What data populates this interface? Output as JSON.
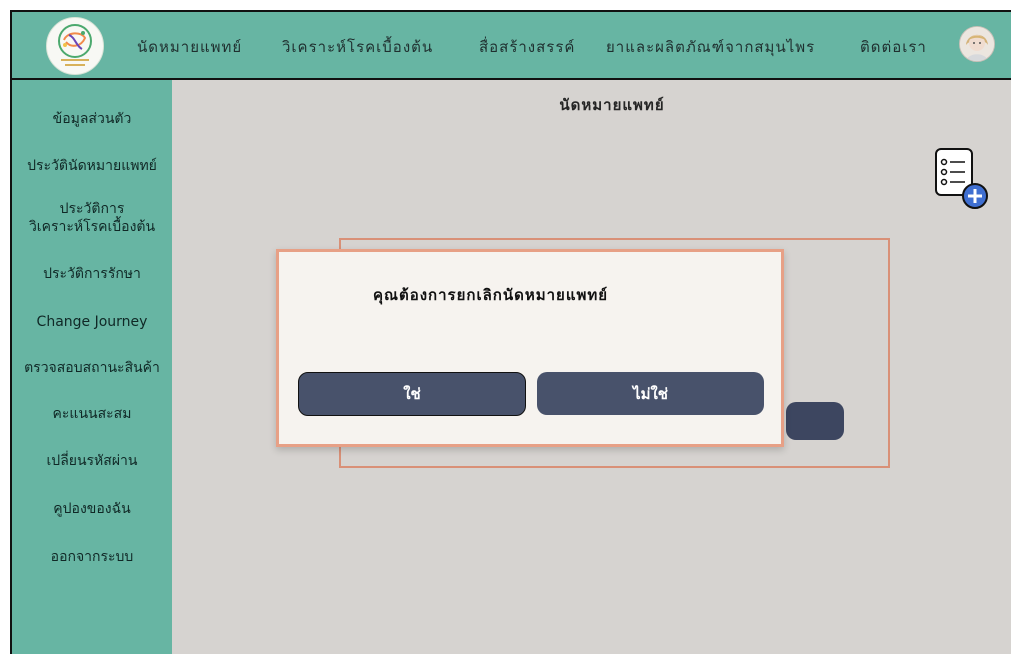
{
  "header": {
    "logo": "health-logo",
    "nav": [
      {
        "label": "นัดหมายแพทย์"
      },
      {
        "label": "วิเคราะห์โรคเบื้องต้น"
      },
      {
        "label": "สื่อสร้างสรรค์"
      },
      {
        "label": "ยาและผลิตภัณฑ์จากสมุนไพร"
      },
      {
        "label": "ติดต่อเรา"
      }
    ],
    "avatar": "user-avatar"
  },
  "sidebar": {
    "items": [
      {
        "label": "ข้อมูลส่วนตัว"
      },
      {
        "label": "ประวัตินัดหมายแพทย์"
      },
      {
        "label": "ประวัติการ\nวิเคราะห์โรคเบื้องต้น"
      },
      {
        "label": "ประวัติการรักษา"
      },
      {
        "label": "Change Journey"
      },
      {
        "label": "ตรวจสอบสถานะสินค้า"
      },
      {
        "label": "คะแนนสะสม"
      },
      {
        "label": "เปลี่ยนรหัสผ่าน"
      },
      {
        "label": "คูปองของฉัน"
      },
      {
        "label": "ออกจากระบบ"
      }
    ]
  },
  "main": {
    "title": "นัดหมายแพทย์",
    "add_icon": "add-appointment-icon"
  },
  "modal": {
    "message": "คุณต้องการยกเลิกนัดหมายแพทย์",
    "yes_label": "ใช่",
    "no_label": "ไม่ใช่"
  },
  "colors": {
    "accent": "#67b5a3",
    "panel": "#d6d3d0",
    "button": "#48526b",
    "modal_border": "#e7a086"
  }
}
